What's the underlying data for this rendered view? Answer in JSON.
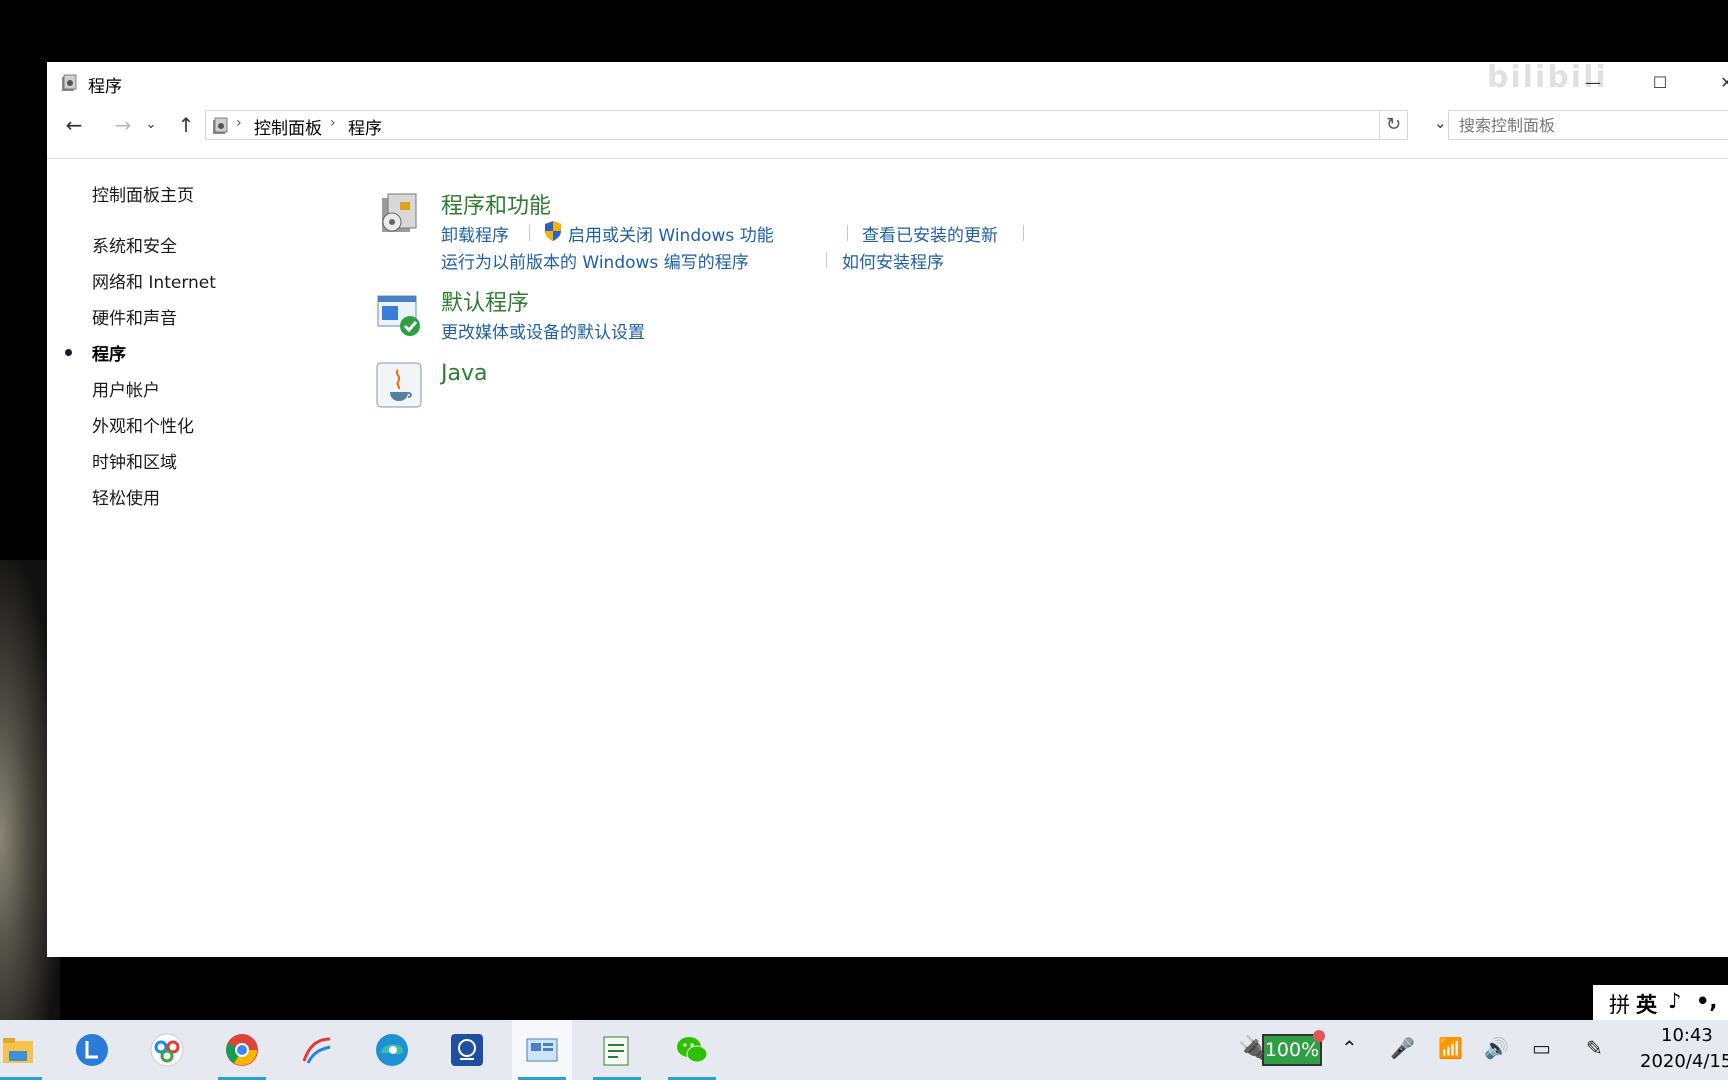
{
  "window": {
    "title": "程序",
    "watermark": "bilibili"
  },
  "navbar": {
    "breadcrumb": [
      "控制面板",
      "程序"
    ],
    "search_placeholder": "搜索控制面板"
  },
  "sidebar": {
    "home": "控制面板主页",
    "items": [
      {
        "label": "系统和安全"
      },
      {
        "label": "网络和 Internet"
      },
      {
        "label": "硬件和声音"
      },
      {
        "label": "程序",
        "active": true
      },
      {
        "label": "用户帐户"
      },
      {
        "label": "外观和个性化"
      },
      {
        "label": "时钟和区域"
      },
      {
        "label": "轻松使用"
      }
    ]
  },
  "categories": [
    {
      "title": "程序和功能",
      "icon": "programs-features-icon",
      "links_row1": [
        "卸载程序",
        "启用或关闭 Windows 功能",
        "查看已安装的更新"
      ],
      "links_row2": [
        "运行为以前版本的 Windows 编写的程序",
        "如何安装程序"
      ]
    },
    {
      "title": "默认程序",
      "icon": "default-programs-icon",
      "links_row1": [
        "更改媒体或设备的默认设置"
      ]
    },
    {
      "title": "Java",
      "icon": "java-icon"
    }
  ],
  "langbar": {
    "mode": "拼",
    "lang": "英"
  },
  "taskbar": {
    "apps": [
      "file-explorer",
      "lark",
      "baidu-netdisk",
      "chrome",
      "feishu",
      "edge",
      "sketch",
      "control-panel",
      "notepad",
      "wechat"
    ],
    "battery": "100%",
    "time": "10:43",
    "date": "2020/4/15"
  },
  "colors": {
    "category_title": "#2e7d32",
    "link": "#1f5fa8",
    "battery": "#2f9e44"
  }
}
